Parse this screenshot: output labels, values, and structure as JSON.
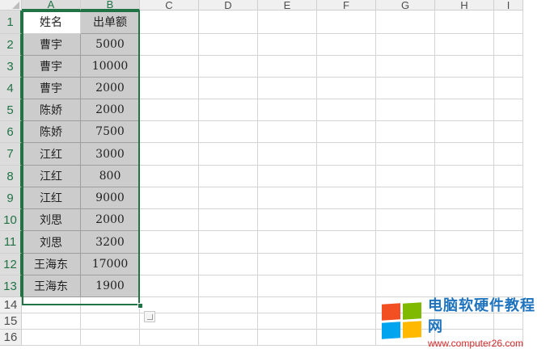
{
  "sheet": {
    "columns": [
      "A",
      "B",
      "C",
      "D",
      "E",
      "F",
      "G",
      "H",
      "I"
    ],
    "rows": [
      "1",
      "2",
      "3",
      "4",
      "5",
      "6",
      "7",
      "8",
      "9",
      "10",
      "11",
      "12",
      "13",
      "14",
      "15",
      "16"
    ],
    "header": {
      "name": "姓名",
      "amount": "出单额"
    },
    "data": [
      {
        "name": "曹宇",
        "amount": "5000"
      },
      {
        "name": "曹宇",
        "amount": "10000"
      },
      {
        "name": "曹宇",
        "amount": "2000"
      },
      {
        "name": "陈娇",
        "amount": "2000"
      },
      {
        "name": "陈娇",
        "amount": "7500"
      },
      {
        "name": "江红",
        "amount": "3000"
      },
      {
        "name": "江红",
        "amount": "800"
      },
      {
        "name": "江红",
        "amount": "9000"
      },
      {
        "name": "刘思",
        "amount": "2000"
      },
      {
        "name": "刘思",
        "amount": "3200"
      },
      {
        "name": "王海东",
        "amount": "17000"
      },
      {
        "name": "王海东",
        "amount": "1900"
      }
    ]
  },
  "colors": {
    "selection": "#217346",
    "cell_fill": "#cccccc",
    "header_bg": "#f0f0f0"
  },
  "watermark": {
    "title": "电脑软硬件教程网",
    "url": "www.computer26.com"
  }
}
